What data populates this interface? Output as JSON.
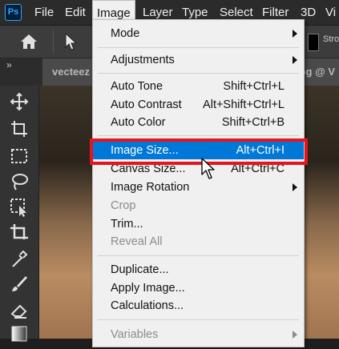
{
  "app": {
    "logo_text": "Ps"
  },
  "menubar": {
    "items": [
      "File",
      "Edit",
      "Image",
      "Layer",
      "Type",
      "Select",
      "Filter",
      "3D",
      "Vi"
    ],
    "active": "Image"
  },
  "options_bar": {
    "right_text": "Stro"
  },
  "tabs": [
    {
      "label": "vecteez"
    },
    {
      "label": "jpg @ V"
    }
  ],
  "tools": [
    "move-icon",
    "artboard-icon",
    "marquee-icon",
    "lasso-icon",
    "object-select-icon",
    "crop-icon",
    "eyedropper-icon",
    "brush-icon",
    "eraser-icon",
    "gradient-icon"
  ],
  "image_menu": {
    "mode": "Mode",
    "adjustments": "Adjustments",
    "auto_tone": {
      "label": "Auto Tone",
      "shortcut": "Shift+Ctrl+L"
    },
    "auto_contrast": {
      "label": "Auto Contrast",
      "shortcut": "Alt+Shift+Ctrl+L"
    },
    "auto_color": {
      "label": "Auto Color",
      "shortcut": "Shift+Ctrl+B"
    },
    "image_size": {
      "label": "Image Size...",
      "shortcut": "Alt+Ctrl+I"
    },
    "canvas_size": {
      "label": "Canvas Size...",
      "shortcut": "Alt+Ctrl+C"
    },
    "image_rotation": "Image Rotation",
    "crop": "Crop",
    "trim": "Trim...",
    "reveal_all": "Reveal All",
    "duplicate": "Duplicate...",
    "apply_image": "Apply Image...",
    "calculations": "Calculations...",
    "variables": "Variables"
  },
  "colors": {
    "highlight": "#0078d7",
    "annotation_box": "#e8141c",
    "ps_blue": "#31a8ff"
  }
}
